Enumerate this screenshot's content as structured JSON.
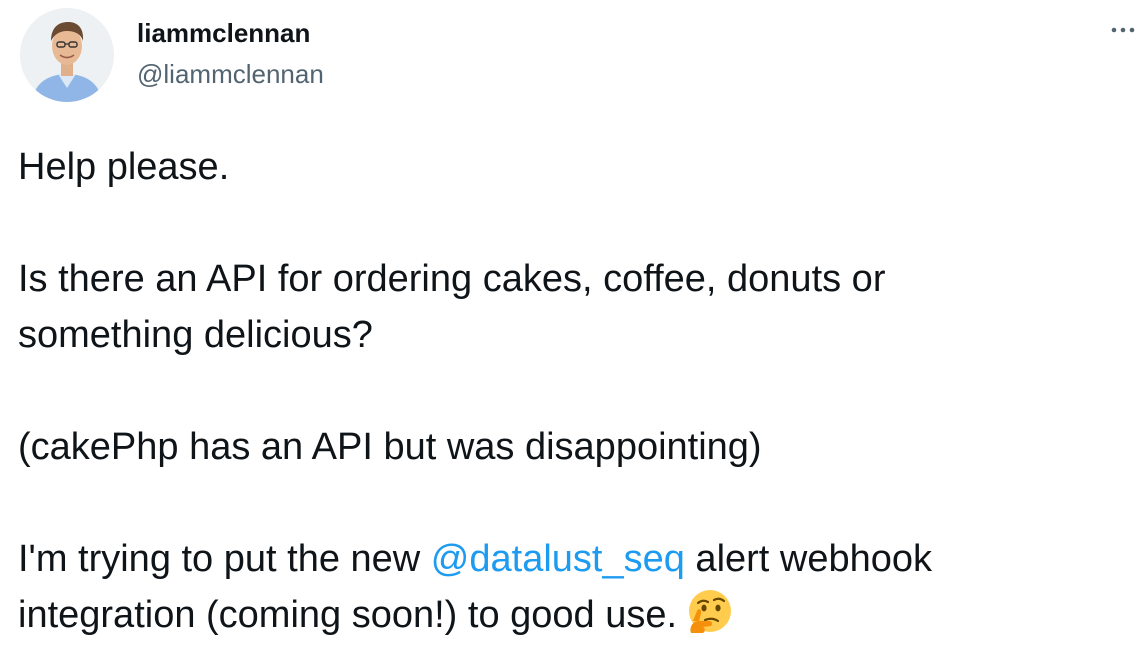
{
  "user": {
    "display_name": "liammclennan",
    "handle": "@liammclennan"
  },
  "menu": {
    "icon": "more-horizontal-icon"
  },
  "tweet": {
    "line1": "Help please.",
    "line2a": "Is there an API for ordering cakes, coffee, donuts or",
    "line2b": "something delicious?",
    "line3": "(cakePhp has an API but was disappointing)",
    "line4_prefix": "I'm trying to put the new ",
    "mention": "@datalust_seq",
    "line4_suffix": " alert webhook",
    "line5": "integration (coming soon!) to good use.",
    "emoji": "thinking-face-emoji"
  },
  "colors": {
    "text": "#0f1419",
    "secondary": "#536471",
    "mention": "#1d9bf0"
  }
}
